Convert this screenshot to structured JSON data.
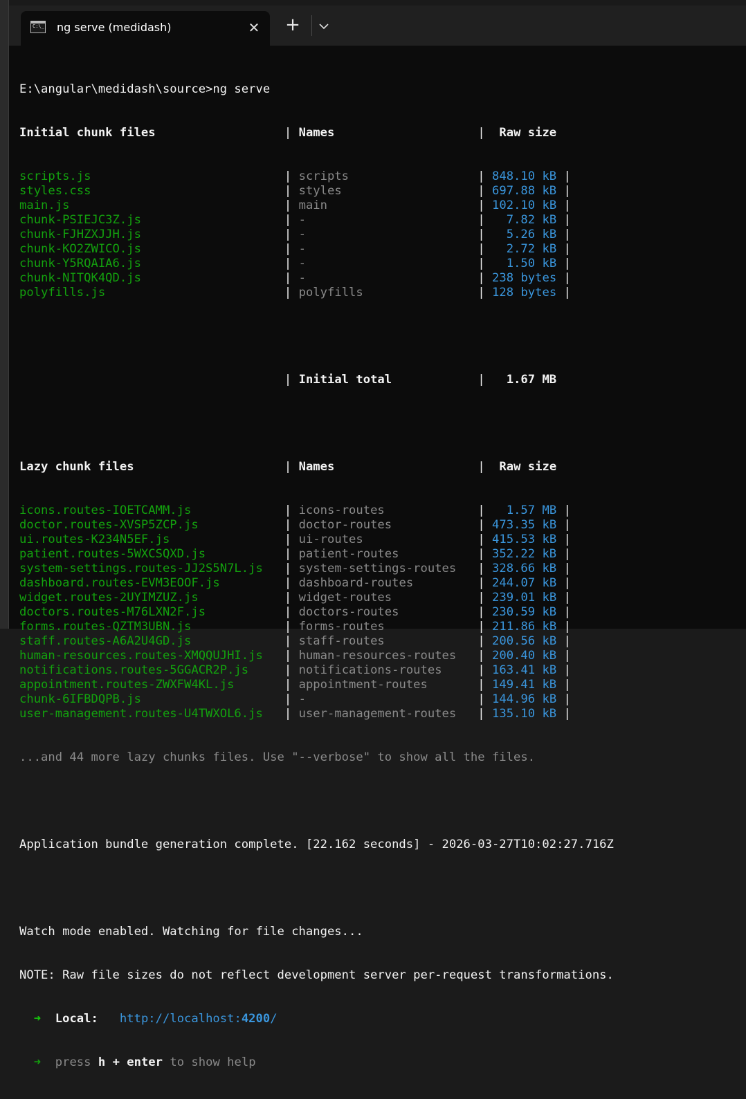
{
  "window": {
    "tab_title": "ng serve (medidash)",
    "close_glyph": "✕",
    "new_tab_glyph": "+",
    "icons": {
      "tab": "terminal-icon",
      "close": "close-icon",
      "new_tab": "plus-icon",
      "dropdown": "chevron-down-icon"
    }
  },
  "terminal": {
    "command_line": "E:\\angular\\medidash\\source>ng serve",
    "sep": "|",
    "initial": {
      "header": {
        "files": "Initial chunk files",
        "names": "Names",
        "size": "Raw size"
      },
      "rows": [
        {
          "file": "scripts.js",
          "name": "scripts",
          "size": "848.10 kB"
        },
        {
          "file": "styles.css",
          "name": "styles",
          "size": "697.88 kB"
        },
        {
          "file": "main.js",
          "name": "main",
          "size": "102.10 kB"
        },
        {
          "file": "chunk-PSIEJC3Z.js",
          "name": "-",
          "size": "7.82 kB"
        },
        {
          "file": "chunk-FJHZXJJH.js",
          "name": "-",
          "size": "5.26 kB"
        },
        {
          "file": "chunk-KO2ZWICO.js",
          "name": "-",
          "size": "2.72 kB"
        },
        {
          "file": "chunk-Y5RQAIA6.js",
          "name": "-",
          "size": "1.50 kB"
        },
        {
          "file": "chunk-NITQK4QD.js",
          "name": "-",
          "size": "238 bytes"
        },
        {
          "file": "polyfills.js",
          "name": "polyfills",
          "size": "128 bytes"
        }
      ],
      "total_label": "Initial total",
      "total_value": "1.67 MB"
    },
    "lazy": {
      "header": {
        "files": "Lazy chunk files",
        "names": "Names",
        "size": "Raw size"
      },
      "rows": [
        {
          "file": "icons.routes-IOETCAMM.js",
          "name": "icons-routes",
          "size": "1.57 MB"
        },
        {
          "file": "doctor.routes-XVSP5ZCP.js",
          "name": "doctor-routes",
          "size": "473.35 kB"
        },
        {
          "file": "ui.routes-K234N5EF.js",
          "name": "ui-routes",
          "size": "415.53 kB"
        },
        {
          "file": "patient.routes-5WXCSQXD.js",
          "name": "patient-routes",
          "size": "352.22 kB"
        },
        {
          "file": "system-settings.routes-JJ2S5N7L.js",
          "name": "system-settings-routes",
          "size": "328.66 kB"
        },
        {
          "file": "dashboard.routes-EVM3EOOF.js",
          "name": "dashboard-routes",
          "size": "244.07 kB"
        },
        {
          "file": "widget.routes-2UYIMZUZ.js",
          "name": "widget-routes",
          "size": "239.01 kB"
        },
        {
          "file": "doctors.routes-M76LXN2F.js",
          "name": "doctors-routes",
          "size": "230.59 kB"
        },
        {
          "file": "forms.routes-QZTM3UBN.js",
          "name": "forms-routes",
          "size": "211.86 kB"
        },
        {
          "file": "staff.routes-A6A2U4GD.js",
          "name": "staff-routes",
          "size": "200.56 kB"
        },
        {
          "file": "human-resources.routes-XMQQUJHI.js",
          "name": "human-resources-routes",
          "size": "200.40 kB"
        },
        {
          "file": "notifications.routes-5GGACR2P.js",
          "name": "notifications-routes",
          "size": "163.41 kB"
        },
        {
          "file": "appointment.routes-ZWXFW4KL.js",
          "name": "appointment-routes",
          "size": "149.41 kB"
        },
        {
          "file": "chunk-6IFBDQPB.js",
          "name": "-",
          "size": "144.96 kB"
        },
        {
          "file": "user-management.routes-U4TWXOL6.js",
          "name": "user-management-routes",
          "size": "135.10 kB"
        }
      ],
      "more_note": "...and 44 more lazy chunks files. Use \"--verbose\" to show all the files."
    },
    "bundle_complete": "Application bundle generation complete. [22.162 seconds] - 2026-03-27T10:02:27.716Z",
    "watch_mode": "Watch mode enabled. Watching for file changes...",
    "note": "NOTE: Raw file sizes do not reflect development server per-request transformations.",
    "arrow": "➜",
    "local_label": "Local:",
    "local_url_prefix": "http://localhost:",
    "local_url_port": "4200",
    "local_url_suffix": "/",
    "help_press": "press",
    "help_key": "h + enter",
    "help_text": "to show help"
  },
  "colors": {
    "background": "#0c0c0c",
    "tabbar": "#202020",
    "filename_green": "#13a10e",
    "size_blue": "#3a96dd",
    "dim_gray": "#8a8a8a",
    "text_white": "#f2f2f2",
    "arrow_green": "#16c60c"
  }
}
